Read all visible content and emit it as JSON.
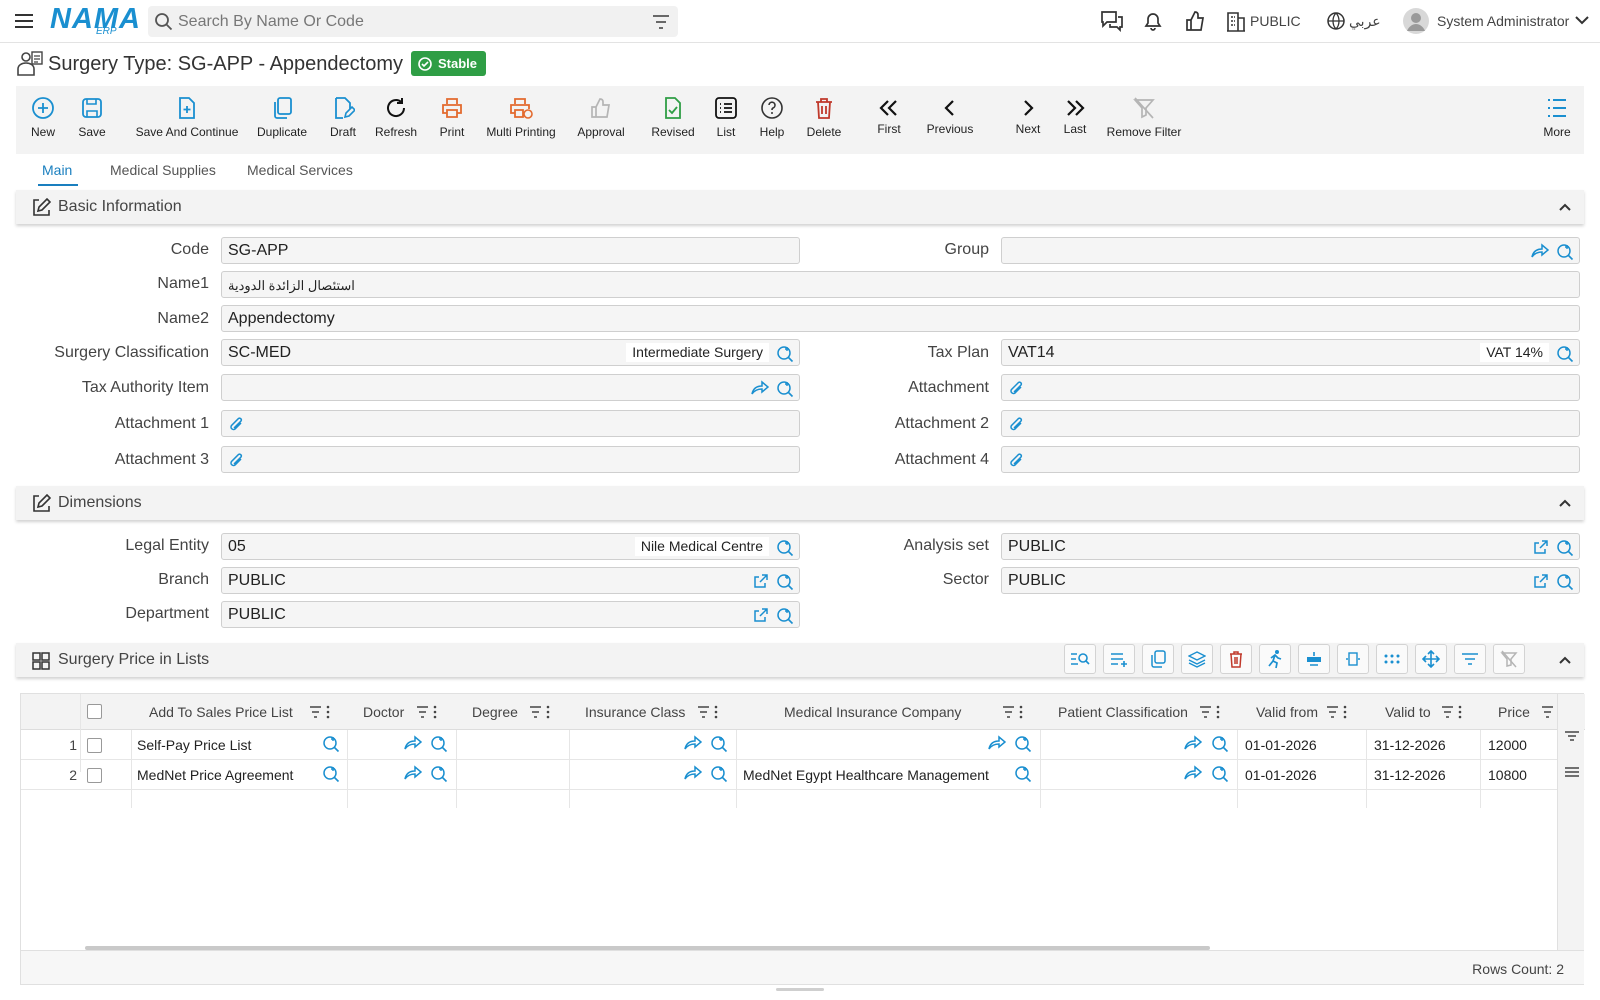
{
  "header": {
    "logo_main": "NAMA",
    "logo_sub": "ERP",
    "search_placeholder": "Search By Name Or Code",
    "entity": "PUBLIC",
    "language": "عربي",
    "user": "System Administrator"
  },
  "page": {
    "title": "Surgery Type: SG-APP - Appendectomy",
    "status": "Stable"
  },
  "toolbar": {
    "buttons": [
      {
        "label": "New",
        "icon": "plus-circle-icon"
      },
      {
        "label": "Save",
        "icon": "save-icon"
      },
      {
        "label": "Save And Continue",
        "icon": "save-continue-icon"
      },
      {
        "label": "Duplicate",
        "icon": "duplicate-icon"
      },
      {
        "label": "Draft",
        "icon": "draft-icon"
      },
      {
        "label": "Refresh",
        "icon": "refresh-icon"
      },
      {
        "label": "Print",
        "icon": "print-icon"
      },
      {
        "label": "Multi Printing",
        "icon": "multi-print-icon"
      },
      {
        "label": "Approval",
        "icon": "thumbs-up-icon"
      },
      {
        "label": "Revised",
        "icon": "revised-icon"
      },
      {
        "label": "List",
        "icon": "list-icon"
      },
      {
        "label": "Help",
        "icon": "help-icon"
      },
      {
        "label": "Delete",
        "icon": "trash-icon"
      },
      {
        "label": "First",
        "icon": "first-icon"
      },
      {
        "label": "Previous",
        "icon": "previous-icon"
      },
      {
        "label": "Next",
        "icon": "next-icon"
      },
      {
        "label": "Last",
        "icon": "last-icon"
      },
      {
        "label": "Remove Filter",
        "icon": "remove-filter-icon"
      },
      {
        "label": "More",
        "icon": "more-icon"
      }
    ]
  },
  "tabs": [
    "Main",
    "Medical Supplies",
    "Medical Services"
  ],
  "basic_info": {
    "title": "Basic Information",
    "code_label": "Code",
    "code_value": "SG-APP",
    "group_label": "Group",
    "group_value": "",
    "name1_label": "Name1",
    "name1_value": "استئصال الزائدة الدودية",
    "name2_label": "Name2",
    "name2_value": "Appendectomy",
    "classification_label": "Surgery Classification",
    "classification_value": "SC-MED",
    "classification_desc": "Intermediate Surgery",
    "tax_plan_label": "Tax Plan",
    "tax_plan_value": "VAT14",
    "tax_plan_desc": "VAT 14%",
    "tax_authority_label": "Tax Authority Item",
    "tax_authority_value": "",
    "attachment_label": "Attachment",
    "attachment1_label": "Attachment 1",
    "attachment2_label": "Attachment 2",
    "attachment3_label": "Attachment 3",
    "attachment4_label": "Attachment 4"
  },
  "dimensions": {
    "title": "Dimensions",
    "legal_entity_label": "Legal Entity",
    "legal_entity_value": "05",
    "legal_entity_desc": "Nile Medical Centre",
    "analysis_set_label": "Analysis set",
    "analysis_set_value": "PUBLIC",
    "branch_label": "Branch",
    "branch_value": "PUBLIC",
    "sector_label": "Sector",
    "sector_value": "PUBLIC",
    "department_label": "Department",
    "department_value": "PUBLIC"
  },
  "price_lists": {
    "title": "Surgery Price in Lists",
    "columns": [
      "Add To Sales Price List",
      "Doctor",
      "Degree",
      "Insurance Class",
      "Medical Insurance Company",
      "Patient Classification",
      "Valid from",
      "Valid to",
      "Price"
    ],
    "rows": [
      {
        "num": "1",
        "price_list": "Self-Pay Price List",
        "doctor": "",
        "degree": "",
        "insurance_class": "",
        "company": "",
        "patient_class": "",
        "valid_from": "01-01-2026",
        "valid_to": "31-12-2026",
        "price": "12000"
      },
      {
        "num": "2",
        "price_list": "MedNet Price Agreement",
        "doctor": "",
        "degree": "",
        "insurance_class": "",
        "company": "MedNet Egypt Healthcare Management",
        "patient_class": "",
        "valid_from": "01-01-2026",
        "valid_to": "31-12-2026",
        "price": "10800"
      }
    ],
    "rows_count": "Rows Count: 2"
  },
  "colors": {
    "accent": "#1a8fd0",
    "status": "#2f9e45",
    "orange": "#e36a2e",
    "green": "#2f9e45",
    "red": "#c0392b"
  }
}
